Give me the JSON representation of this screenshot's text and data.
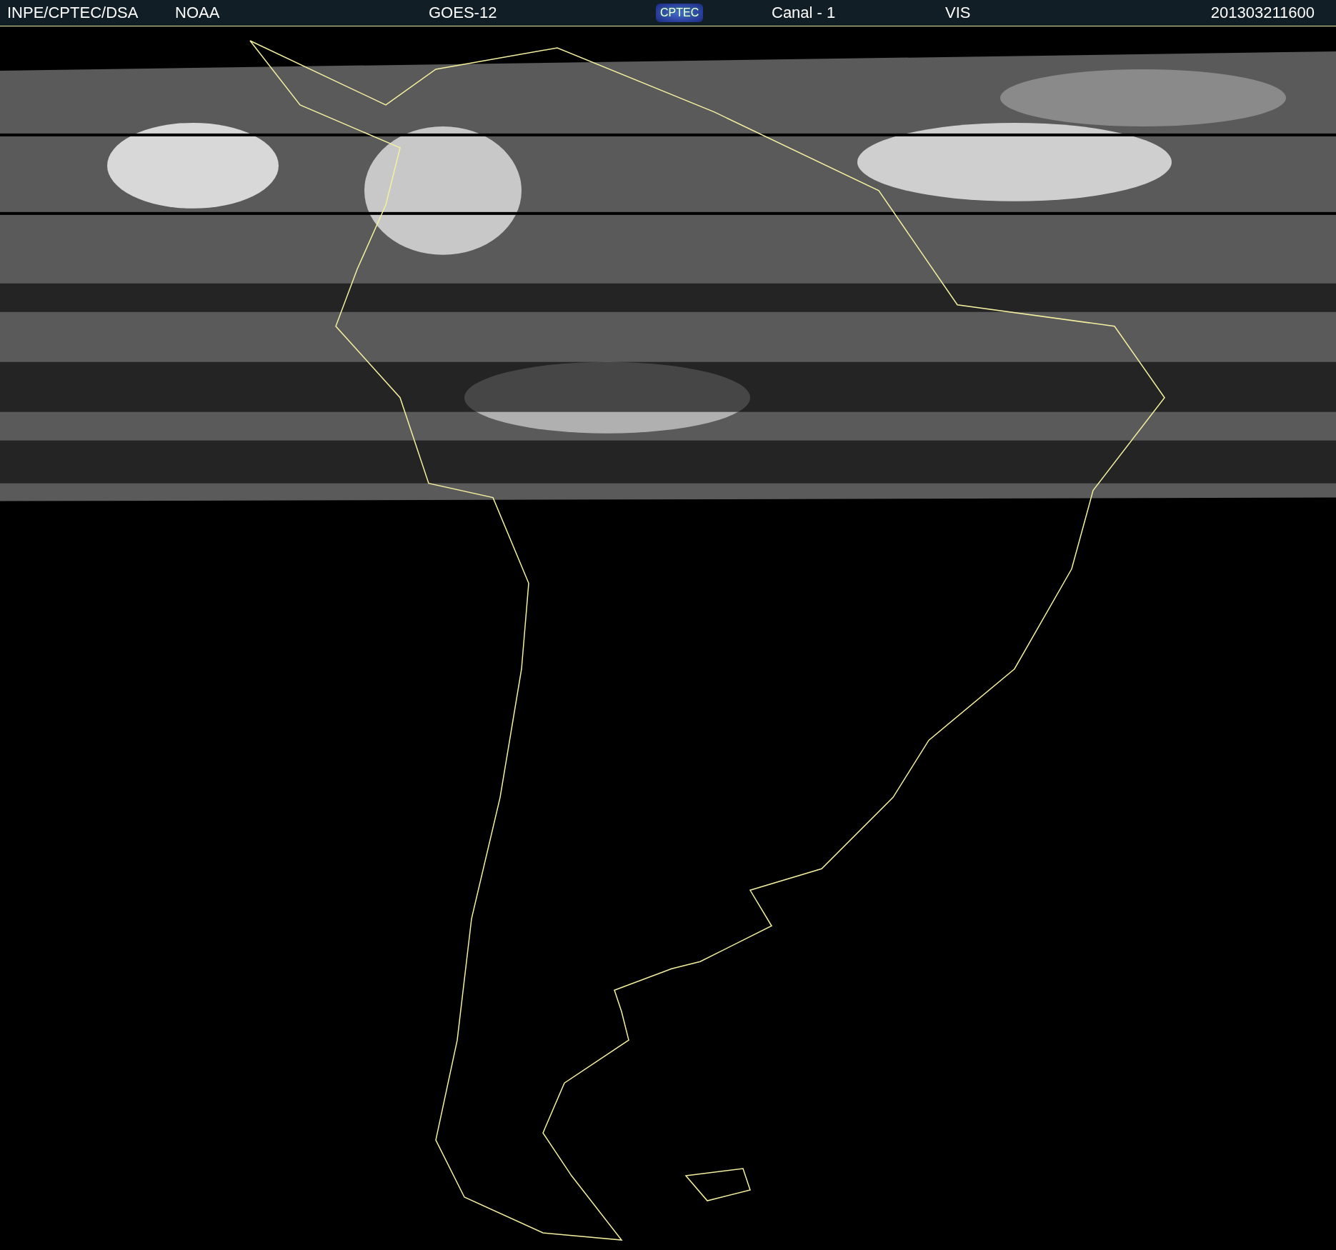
{
  "header": {
    "institution": "INPE/CPTEC/DSA",
    "agency": "NOAA",
    "satellite": "GOES-12",
    "logo": "CPTEC",
    "channel": "Canal - 1",
    "band": "VIS",
    "timestamp": "201303211600"
  }
}
